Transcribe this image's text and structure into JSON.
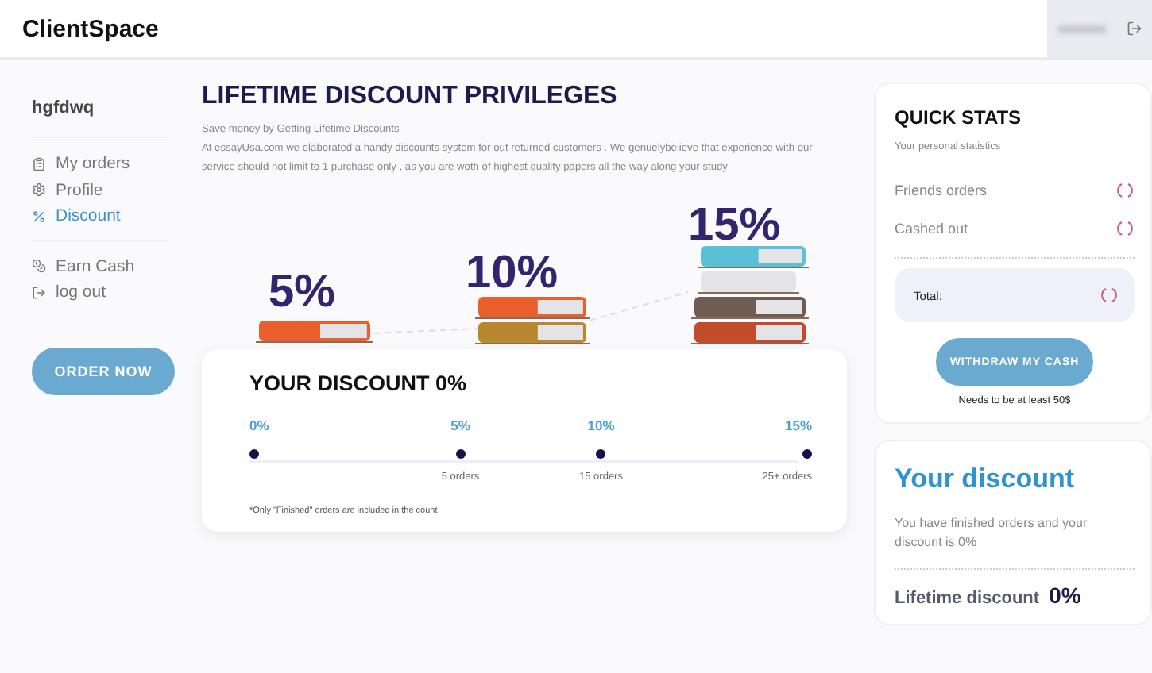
{
  "header": {
    "logo": "ClientSpace"
  },
  "sidebar": {
    "username": "hgfdwq",
    "groups": [
      [
        {
          "label": "My orders",
          "selected": false
        },
        {
          "label": "Profile",
          "selected": false
        },
        {
          "label": "Discount",
          "selected": true
        }
      ],
      [
        {
          "label": "Earn Cash",
          "selected": false
        },
        {
          "label": "log out",
          "selected": false
        }
      ]
    ],
    "order_button": "ORDER NOW"
  },
  "main": {
    "title": "LIFETIME DISCOUNT PRIVILEGES",
    "subtitle": "Save money by Getting Lifetime Discounts",
    "intro": "At essayUsa.com we elaborated a handy discounts system for out returned customers . We genuelybelieve that experience with our service should not limit to 1 purchase only , as you are woth of highest quality papers all the way along your study",
    "tiers": [
      "5%",
      "10%",
      "15%"
    ],
    "discount_card": {
      "title": "YOUR DISCOUNT 0%",
      "milestones": [
        {
          "percent": "0%"
        },
        {
          "percent": "5%",
          "orders": "5 orders"
        },
        {
          "percent": "10%",
          "orders": "15 orders"
        },
        {
          "percent": "15%",
          "orders": "25+ orders"
        }
      ],
      "note": "*Only \"Finished\" orders are included in the count"
    }
  },
  "quick_stats": {
    "title": "QUICK STATS",
    "subtitle": "Your personal statistics",
    "rows": [
      "Friends orders",
      "Cashed out"
    ],
    "total_label": "Total:",
    "button": "WITHDRAW MY CASH",
    "hint": "Needs to be at least 50$"
  },
  "your_discount": {
    "title": "Your discount",
    "text": "You have finished orders and your discount is 0%",
    "label": "Lifetime discount",
    "value": "0%"
  }
}
